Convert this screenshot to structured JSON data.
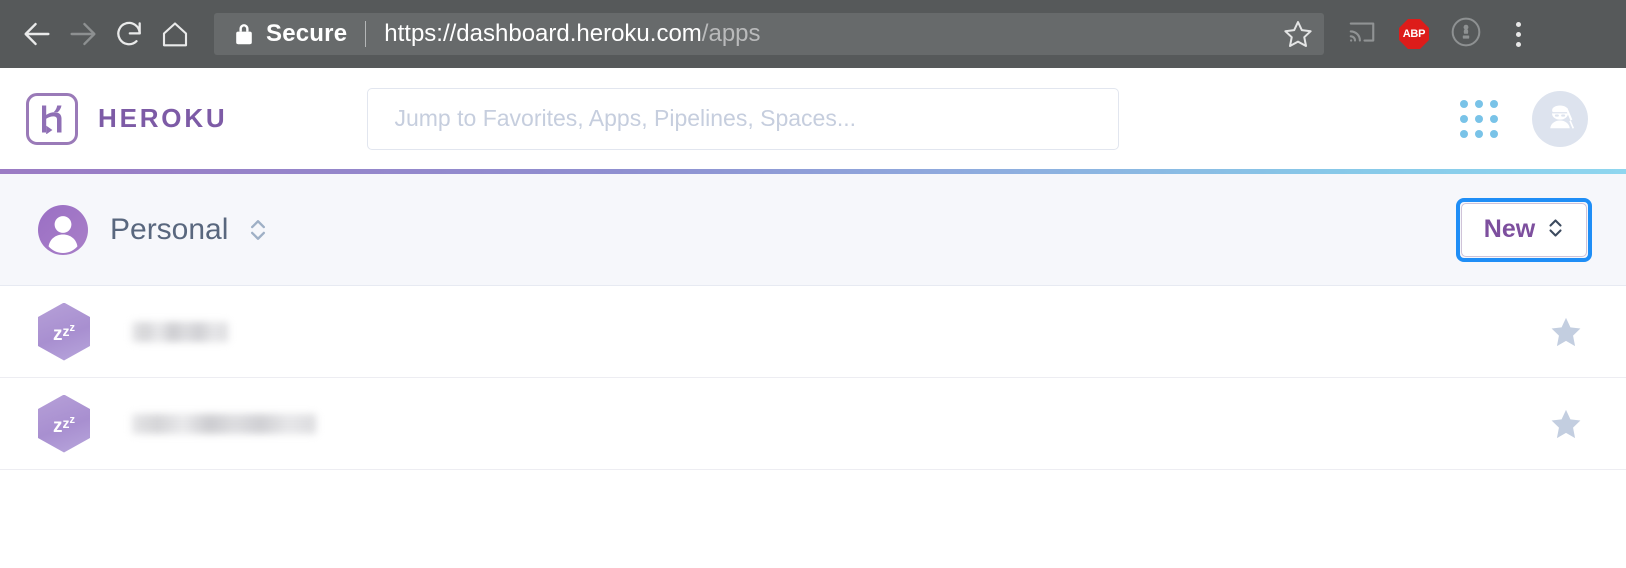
{
  "browser": {
    "back_icon": "back-arrow-icon",
    "forward_icon": "forward-arrow-icon",
    "reload_icon": "reload-icon",
    "home_icon": "home-icon",
    "security_label": "Secure",
    "lock_icon": "lock-icon",
    "url_host": "https://dashboard.heroku.com",
    "url_path": "/apps",
    "bookmark_icon": "star-outline-icon",
    "cast_icon": "cast-icon",
    "extension_label": "ABP",
    "extension_icon": "adblock-plus-icon",
    "info_icon": "info-circle-icon",
    "menu_icon": "kebab-menu-icon",
    "colors": {
      "toolbar_bg": "#56595a",
      "omnibox_bg": "#676a6b",
      "abp_red": "#dd1c1a"
    }
  },
  "header": {
    "logo_icon": "heroku-logo-icon",
    "brand": "HEROKU",
    "search": {
      "placeholder": "Jump to Favorites, Apps, Pipelines, Spaces...",
      "value": ""
    },
    "app_switcher_icon": "grid-apps-icon",
    "avatar_icon": "ninja-avatar-icon",
    "colors": {
      "brand_purple": "#7d5ba6",
      "grid_blue": "#79c3e8",
      "gradient_start": "#9b7bc4",
      "gradient_end": "#8fd6ef"
    }
  },
  "team_bar": {
    "avatar_icon": "person-avatar-icon",
    "name": "Personal",
    "selector_icon": "chevron-up-down-icon",
    "new_button": {
      "label": "New",
      "chevron_icon": "chevron-up-down-icon",
      "focused": true,
      "focus_color": "#1f8ef6",
      "text_color": "#7d4f9e"
    }
  },
  "app_list": {
    "rows": [
      {
        "status_icon": "sleeping-app-hexagon-icon",
        "status_glyph": "zzz",
        "name": "",
        "name_redacted": true,
        "name_width": 96,
        "favorite_icon": "star-filled-icon",
        "favorited": true
      },
      {
        "status_icon": "sleeping-app-hexagon-icon",
        "status_glyph": "zzz",
        "name": "",
        "name_redacted": true,
        "name_width": 184,
        "favorite_icon": "star-filled-icon",
        "favorited": true
      }
    ],
    "star_color": "#c3cee0"
  }
}
